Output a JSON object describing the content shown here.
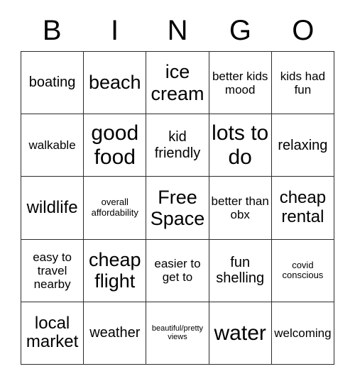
{
  "header": {
    "letters": [
      "B",
      "I",
      "N",
      "G",
      "O"
    ]
  },
  "grid": {
    "columns": 5,
    "rows": 5,
    "border_color": "#2b2b2b",
    "background_color": "#ffffff",
    "text_color": "#000000",
    "cells": [
      {
        "text": "boating",
        "size": "md"
      },
      {
        "text": "beach",
        "size": "xl"
      },
      {
        "text": "ice cream",
        "size": "xl"
      },
      {
        "text": "better kids mood",
        "size": "sm"
      },
      {
        "text": "kids had fun",
        "size": "sm"
      },
      {
        "text": "walkable",
        "size": "sm"
      },
      {
        "text": "good food",
        "size": "xxl"
      },
      {
        "text": "kid friendly",
        "size": "md"
      },
      {
        "text": "lots to do",
        "size": "xxl"
      },
      {
        "text": "relaxing",
        "size": "md"
      },
      {
        "text": "wildlife",
        "size": "lg"
      },
      {
        "text": "overall affordability",
        "size": "xs"
      },
      {
        "text": "Free Space",
        "size": "xl"
      },
      {
        "text": "better than obx",
        "size": "sm"
      },
      {
        "text": "cheap rental",
        "size": "lg"
      },
      {
        "text": "easy to travel nearby",
        "size": "sm"
      },
      {
        "text": "cheap flight",
        "size": "xl"
      },
      {
        "text": "easier to get to",
        "size": "sm"
      },
      {
        "text": "fun shelling",
        "size": "md"
      },
      {
        "text": "covid conscious",
        "size": "xs"
      },
      {
        "text": "local market",
        "size": "lg"
      },
      {
        "text": "weather",
        "size": "md"
      },
      {
        "text": "beautiful/pretty views",
        "size": "xxs"
      },
      {
        "text": "water",
        "size": "xxl"
      },
      {
        "text": "welcoming",
        "size": "sm"
      }
    ]
  }
}
